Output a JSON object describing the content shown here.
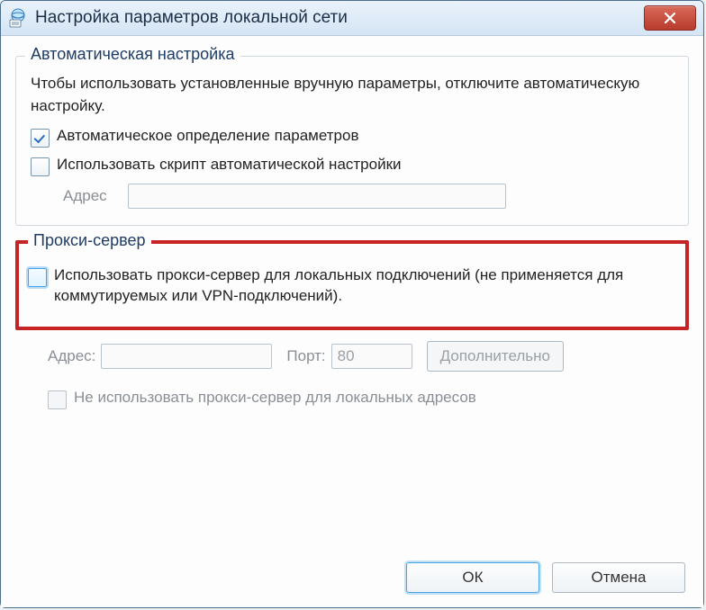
{
  "window": {
    "title": "Настройка параметров локальной сети"
  },
  "auto": {
    "legend": "Автоматическая настройка",
    "helptext": "Чтобы использовать установленные вручную параметры, отключите автоматическую настройку.",
    "auto_detect_label": "Автоматическое определение параметров",
    "auto_detect_checked": true,
    "use_script_label": "Использовать скрипт автоматической настройки",
    "use_script_checked": false,
    "address_label": "Адрес",
    "address_value": ""
  },
  "proxy": {
    "legend": "Прокси-сервер",
    "use_proxy_label": "Использовать прокси-сервер для локальных подключений (не применяется для коммутируемых или VPN-подключений).",
    "use_proxy_checked": false,
    "address_label": "Адрес:",
    "address_value": "",
    "port_label": "Порт:",
    "port_value": "80",
    "advanced_label": "Дополнительно",
    "bypass_local_label": "Не использовать прокси-сервер для локальных адресов",
    "bypass_local_checked": false
  },
  "buttons": {
    "ok": "ОК",
    "cancel": "Отмена"
  }
}
